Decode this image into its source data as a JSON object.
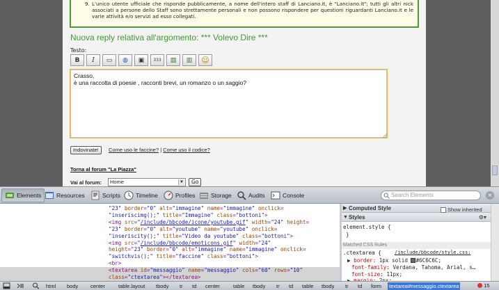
{
  "page": {
    "rules_item_number": "9.",
    "rules_text": "L'unico utente ufficiale che risponde pubblicamente, a nome dell'intero staff di Lanciano.it, è \"Lanciano.it\"; tutti gli altri nick associati a persone dello Staff sono strettamente personali e non possono rispondere per questioni riguardanti Lanciano.it e le varie attività e/o servizi ad esso collegati.",
    "reply_title": "Nuova reply relativa all'argomento: *** Volevo Dire ***",
    "testo_label": "Testo:",
    "bbcode_buttons": [
      "B",
      "I",
      "▭",
      "◍",
      "▣",
      "333",
      "▨",
      "▥",
      "☺"
    ],
    "message_text": "Crasso,\nè una raccolta di poesie , racconti brevi, un romanzo o un saggio?",
    "indovinate_label": "Indovinate!",
    "help_link_1": "Come uso le faccine?",
    "help_separator": "|",
    "help_link_2": "Come uso il codice?",
    "back_link": "Torna al forum \"La Piazza\"",
    "vai_label": "Vai al forum:",
    "forum_select_value": "Home",
    "go_label": "Go"
  },
  "devtools": {
    "tabs": [
      {
        "label": "Elements",
        "active": true
      },
      {
        "label": "Resources",
        "active": false
      },
      {
        "label": "Scripts",
        "active": false
      },
      {
        "label": "Timeline",
        "active": false
      },
      {
        "label": "Profiles",
        "active": false
      },
      {
        "label": "Storage",
        "active": false
      },
      {
        "label": "Audits",
        "active": false
      },
      {
        "label": "Console",
        "active": false
      }
    ],
    "search_placeholder": "Search Elements",
    "close_glyph": "×",
    "dom_lines": [
      {
        "html": "<span class=\"v\">\"23\"</span> <span class=\"a\">border</span>=<span class=\"v\">\"0\"</span> <span class=\"a\">alt</span>=<span class=\"v\">\"immagine\"</span> <span class=\"a\">name</span>=<span class=\"v\">\"immagine\"</span> <span class=\"a\">onclick</span>="
      },
      {
        "html": "<span class=\"v\">\"inseriscimg();\"</span> <span class=\"a\">title</span>=<span class=\"v\">\"Immagine\"</span> <span class=\"a\">class</span>=<span class=\"v\">\"bottoni\"</span>&gt;"
      },
      {
        "html": "&lt;<span class=\"t\">img</span> <span class=\"a\">src</span>=<span class=\"v\">\"</span><span class=\"u\">/include/bbcode/icone/youtube.gif</span><span class=\"v\">\"</span> <span class=\"a\">width</span>=<span class=\"v\">\"24\"</span> <span class=\"a\">height</span>="
      },
      {
        "html": "<span class=\"v\">\"23\"</span> <span class=\"a\">border</span>=<span class=\"v\">\"0\"</span> <span class=\"a\">alt</span>=<span class=\"v\">\"youtube\"</span> <span class=\"a\">name</span>=<span class=\"v\">\"youtube\"</span> <span class=\"a\">onclick</span>="
      },
      {
        "html": "<span class=\"v\">\"inseriscity();\"</span> <span class=\"a\">title</span>=<span class=\"v\">\"Video da youtube\"</span> <span class=\"a\">class</span>=<span class=\"v\">\"bottoni\"</span>&gt;"
      },
      {
        "html": "&lt;<span class=\"t\">img</span> <span class=\"a\">src</span>=<span class=\"v\">\"</span><span class=\"u\">/include/bbcode/emoticons.gif</span><span class=\"v\">\"</span> <span class=\"a\">width</span>=<span class=\"v\">\"24\"</span>"
      },
      {
        "html": "<span class=\"a\">height</span>=<span class=\"v\">\"23\"</span> <span class=\"a\">border</span>=<span class=\"v\">\"0\"</span> <span class=\"a\">alt</span>=<span class=\"v\">\"immagine\"</span> <span class=\"a\">name</span>=<span class=\"v\">\"immagine\"</span> <span class=\"a\">onclick</span>="
      },
      {
        "html": "<span class=\"v\">\"switchvis();\"</span> <span class=\"a\">title</span>=<span class=\"v\">\"faccine\"</span> <span class=\"a\">class</span>=<span class=\"v\">\"bottoni\"</span>&gt;"
      },
      {
        "html": "&lt;<span class=\"t\">br</span>&gt;"
      },
      {
        "html": "&lt;<span class=\"t\">textarea</span> <span class=\"a\">id</span>=<span class=\"v\">\"messaggio\"</span> <span class=\"a\">name</span>=<span class=\"v\">\"messaggio\"</span> <span class=\"a\">cols</span>=<span class=\"v\">\"60\"</span> <span class=\"a\">rows</span>=<span class=\"v\">\"10\"</span>",
        "selected": true
      },
      {
        "html": "<span class=\"a\">class</span>=<span class=\"v\">\"ctextarea\"</span>&gt;&lt;/<span class=\"t\">textarea</span>&gt;",
        "selected": true
      }
    ],
    "styles": {
      "computed_header": "Computed Style",
      "show_inherited": "Show inherited",
      "styles_header": "Styles",
      "element_style": "element.style {",
      "element_style_close": "}",
      "matched_label": "Matched CSS Rules",
      "rule_selector": ".ctextarea {",
      "rule_source": "/include/bbcode/style.css:",
      "props": [
        {
          "name": "border",
          "value": "1px solid",
          "color": "#6C6C6C"
        },
        {
          "name": "font-family",
          "value": "Verdana, Tahoma, Arial, s…"
        },
        {
          "name": "font-size",
          "value": "11px"
        },
        {
          "name": "margin",
          "value": "2px"
        }
      ]
    },
    "breadcrumbs": [
      "html",
      "body",
      "center",
      "table.layout",
      "tbody",
      "tr",
      "td",
      "center",
      "table",
      "tbody",
      "tr",
      "td",
      "table",
      "tbody",
      "tr",
      "td",
      "form",
      "textarea#messaggio.ctextarea"
    ],
    "error_count": "15"
  }
}
